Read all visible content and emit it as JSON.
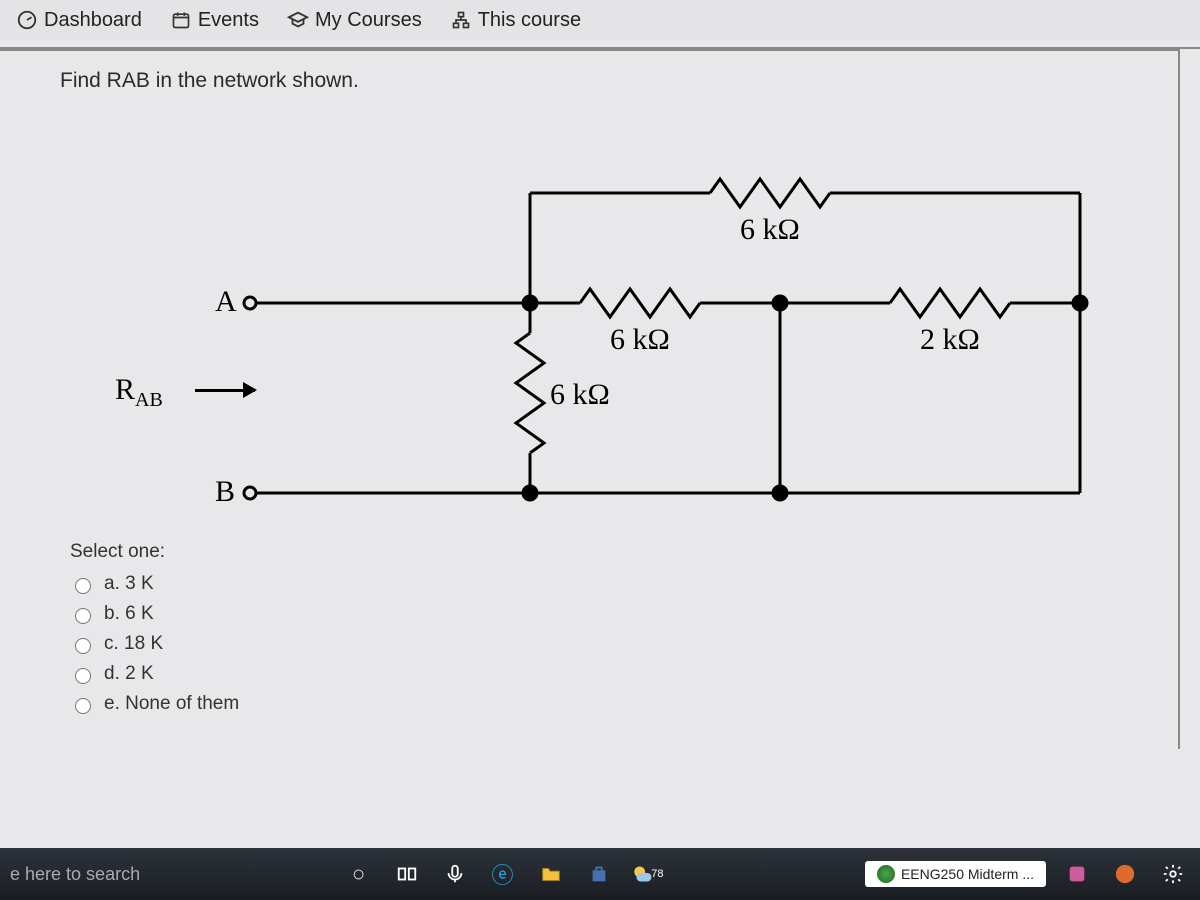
{
  "topbar": {
    "dashboard": "Dashboard",
    "events": "Events",
    "mycourses": "My Courses",
    "thiscourse": "This course"
  },
  "question": {
    "text": "Find RAB in the network shown."
  },
  "circuit": {
    "terminalA": "A",
    "terminalB": "B",
    "rab": "R",
    "rab_sub": "AB",
    "top_res": "6 kΩ",
    "mid_res": "6 kΩ",
    "vert_res": "6 kΩ",
    "right_res": "2 kΩ"
  },
  "options": {
    "prompt": "Select one:",
    "a": "a. 3 K",
    "b": "b. 6 K",
    "c": "c. 18 K",
    "d": "d. 2 K",
    "e": "e. None of them"
  },
  "taskbar": {
    "search": "e here to search",
    "doc": "EENG250 Midterm ...",
    "weather": "78"
  }
}
